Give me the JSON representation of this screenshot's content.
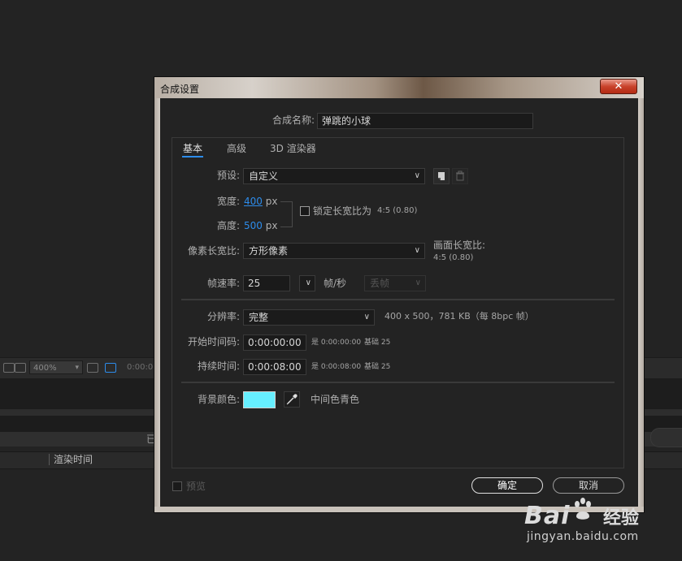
{
  "background": {
    "zoom": "400%",
    "timecode": "0:00:0",
    "render_time_header": "渲染时间",
    "peek_char": "已"
  },
  "dialog": {
    "title": "合成设置",
    "close_glyph": "✕",
    "comp_name_label": "合成名称:",
    "comp_name_value": "弹跳的小球",
    "tabs": [
      {
        "label": "基本",
        "active": true
      },
      {
        "label": "高级",
        "active": false
      },
      {
        "label": "3D 渲染器",
        "active": false
      }
    ],
    "preset": {
      "label": "预设:",
      "value": "自定义"
    },
    "width": {
      "label": "宽度:",
      "value": "400",
      "unit": "px"
    },
    "height": {
      "label": "高度:",
      "value": "500",
      "unit": "px"
    },
    "lock_aspect": {
      "label": "锁定长宽比为",
      "ratio": "4:5 (0.80)",
      "checked": false
    },
    "pixel_aspect": {
      "label": "像素长宽比:",
      "value": "方形像素"
    },
    "frame_aspect": {
      "label": "画面长宽比:",
      "value": "4:5 (0.80)"
    },
    "frame_rate": {
      "label": "帧速率:",
      "value": "25",
      "unit": "帧/秒",
      "drop_frame": "丢帧"
    },
    "resolution": {
      "label": "分辨率:",
      "value": "完整",
      "info": "400 x 500，781 KB（每 8bpc 帧）"
    },
    "start_timecode": {
      "label": "开始时间码:",
      "value": "0:00:00:00",
      "equals": "是 0:00:00:00",
      "base": "基础 25"
    },
    "duration": {
      "label": "持续时间:",
      "value": "0:00:08:00",
      "equals": "是 0:00:08:00",
      "base": "基础 25"
    },
    "bg_color": {
      "label": "背景颜色:",
      "name": "中间色青色",
      "color": "#66efff"
    },
    "preview": {
      "label": "预览",
      "checked": false
    },
    "ok_button": "确定",
    "cancel_button": "取消"
  },
  "icons": {
    "dropdown": "chevron-down-icon",
    "new_preset": "new-preset-icon",
    "delete_preset": "trash-icon",
    "eyedropper": "eyedropper-icon"
  },
  "watermark": {
    "logo_text": "Bai",
    "logo_text2": "经验",
    "url": "jingyan.baidu.com"
  },
  "colors": {
    "accent": "#2d8ceb",
    "dialog_bg": "#232323",
    "swatch": "#66efff"
  }
}
